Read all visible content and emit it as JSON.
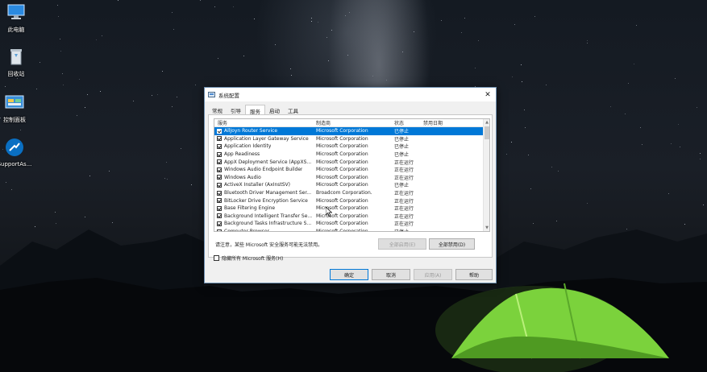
{
  "desktop": {
    "icons": [
      {
        "label": "此电脑",
        "icon": "computer-icon"
      },
      {
        "label": "回收站",
        "icon": "recycle-bin-icon"
      },
      {
        "label": "控制面板",
        "icon": "control-panel-icon"
      },
      {
        "label": "SupportAs...",
        "icon": "support-assist-icon"
      }
    ]
  },
  "dialog": {
    "title": "系统配置",
    "close_glyph": "✕",
    "tabs": [
      {
        "label": "常规"
      },
      {
        "label": "引导"
      },
      {
        "label": "服务",
        "active": true
      },
      {
        "label": "启动"
      },
      {
        "label": "工具"
      }
    ],
    "columns": [
      "服务",
      "制造商",
      "状态",
      "禁用日期"
    ],
    "services": [
      {
        "name": "AllJoyn Router Service",
        "manufacturer": "Microsoft Corporation",
        "status": "已停止",
        "disabled_date": "",
        "checked": true,
        "selected": true
      },
      {
        "name": "Application Layer Gateway Service",
        "manufacturer": "Microsoft Corporation",
        "status": "已停止",
        "disabled_date": "",
        "checked": true
      },
      {
        "name": "Application Identity",
        "manufacturer": "Microsoft Corporation",
        "status": "已停止",
        "disabled_date": "",
        "checked": true
      },
      {
        "name": "App Readiness",
        "manufacturer": "Microsoft Corporation",
        "status": "已停止",
        "disabled_date": "",
        "checked": true
      },
      {
        "name": "AppX Deployment Service (AppXS...",
        "manufacturer": "Microsoft Corporation",
        "status": "正在运行",
        "disabled_date": "",
        "checked": true
      },
      {
        "name": "Windows Audio Endpoint Builder",
        "manufacturer": "Microsoft Corporation",
        "status": "正在运行",
        "disabled_date": "",
        "checked": true
      },
      {
        "name": "Windows Audio",
        "manufacturer": "Microsoft Corporation",
        "status": "正在运行",
        "disabled_date": "",
        "checked": true
      },
      {
        "name": "ActiveX Installer (AxInstSV)",
        "manufacturer": "Microsoft Corporation",
        "status": "已停止",
        "disabled_date": "",
        "checked": true
      },
      {
        "name": "Bluetooth Driver Management Ser...",
        "manufacturer": "Broadcom Corporation.",
        "status": "正在运行",
        "disabled_date": "",
        "checked": true
      },
      {
        "name": "BitLocker Drive Encryption Service",
        "manufacturer": "Microsoft Corporation",
        "status": "正在运行",
        "disabled_date": "",
        "checked": true
      },
      {
        "name": "Base Filtering Engine",
        "manufacturer": "Microsoft Corporation",
        "status": "正在运行",
        "disabled_date": "",
        "checked": true
      },
      {
        "name": "Background Intelligent Transfer Se...",
        "manufacturer": "Microsoft Corporation",
        "status": "正在运行",
        "disabled_date": "",
        "checked": true
      },
      {
        "name": "Background Tasks Infrastructure S...",
        "manufacturer": "Microsoft Corporation",
        "status": "正在运行",
        "disabled_date": "",
        "checked": true
      },
      {
        "name": "Computer Browser",
        "manufacturer": "Microsoft Corporation",
        "status": "已停止",
        "disabled_date": "",
        "checked": true
      }
    ],
    "note": "请注意，某些 Microsoft 安全服务可能无法禁用。",
    "enable_all_label": "全部启用(E)",
    "disable_all_label": "全部禁用(D)",
    "hide_ms_label": "隐藏所有 Microsoft 服务(H)",
    "ok_label": "确定",
    "cancel_label": "取消",
    "apply_label": "应用(A)",
    "help_label": "帮助"
  },
  "colors": {
    "selection": "#0078d7",
    "tent": "#7bd23c"
  }
}
